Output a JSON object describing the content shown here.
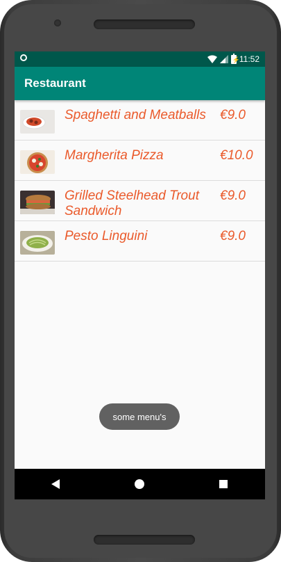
{
  "status_bar": {
    "time": "11:52",
    "battery_icon": "battery-charging-icon"
  },
  "app_bar": {
    "title": "Restaurant"
  },
  "menu": [
    {
      "name": "Spaghetti and Meatballs",
      "price": "€9.0",
      "image": "spaghetti-image"
    },
    {
      "name": "Margherita Pizza",
      "price": "€10.0",
      "image": "pizza-image"
    },
    {
      "name": "Grilled Steelhead Trout Sandwich",
      "price": "€9.0",
      "image": "sandwich-image"
    },
    {
      "name": "Pesto Linguini",
      "price": "€9.0",
      "image": "linguini-image"
    }
  ],
  "toast": {
    "text": "some menu's"
  },
  "colors": {
    "primary": "#008577",
    "primary_dark": "#00574b",
    "accent_text": "#ea5a2b"
  }
}
